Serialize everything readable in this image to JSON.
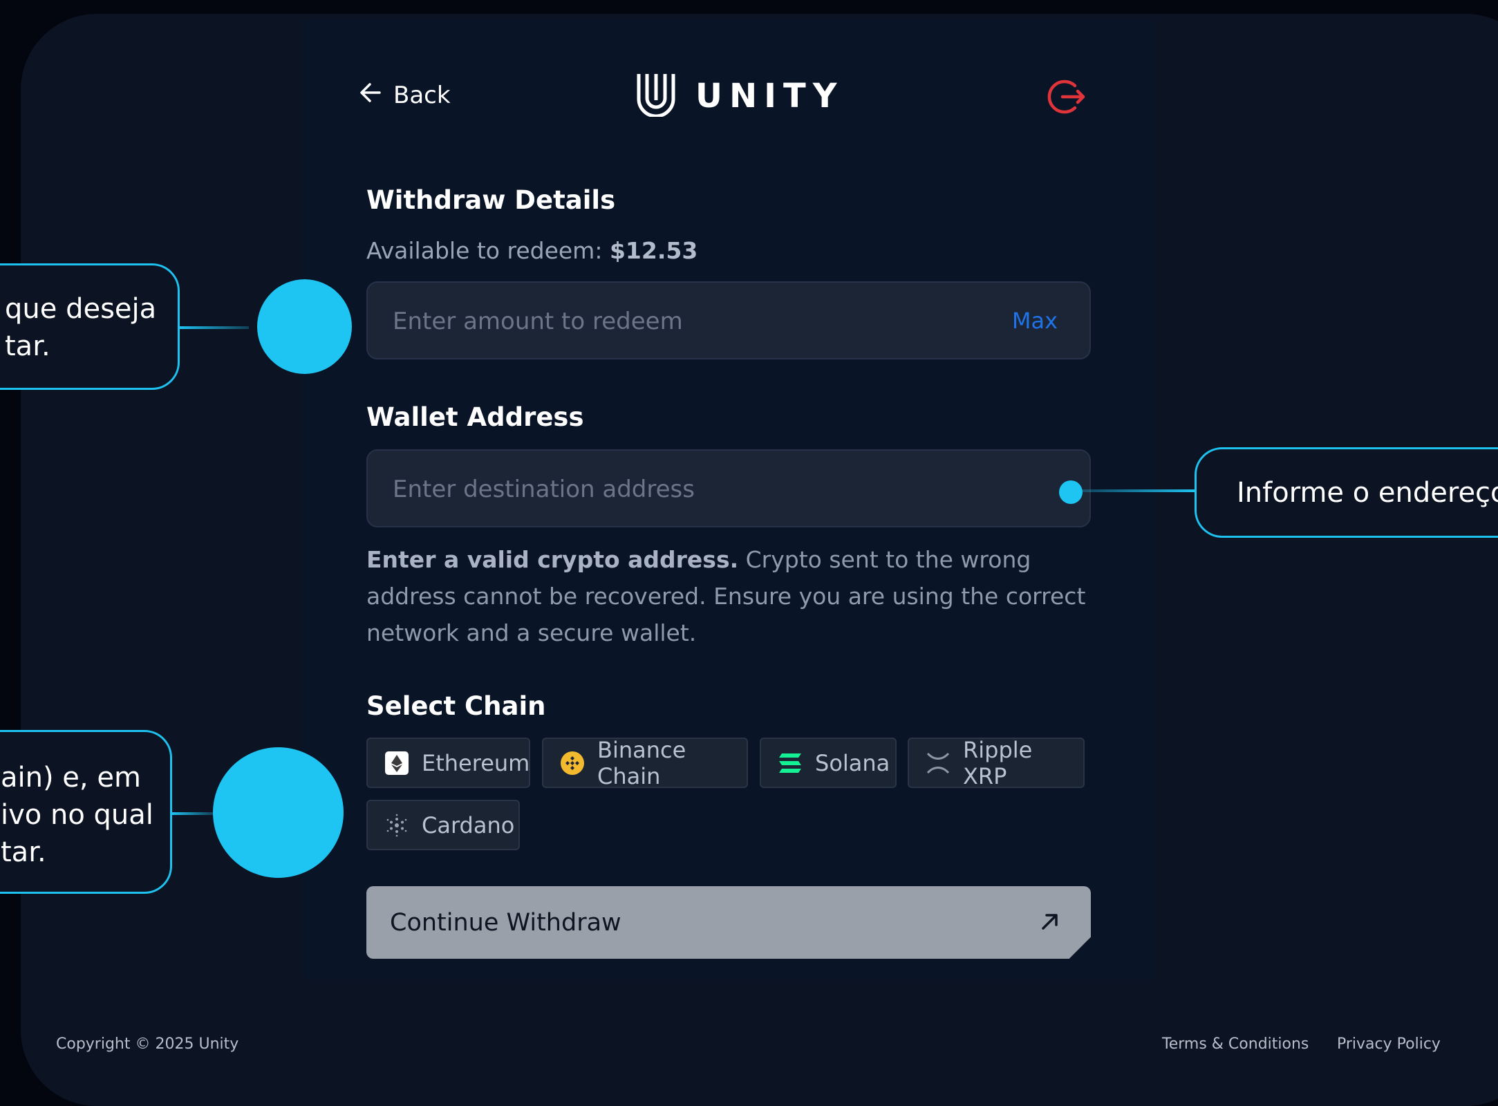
{
  "header": {
    "back_label": "Back",
    "brand_name": "UNITY"
  },
  "withdraw": {
    "title": "Withdraw Details",
    "available_label": "Available to redeem:",
    "available_amount": "$12.53",
    "amount_placeholder": "Enter amount to redeem",
    "max_label": "Max"
  },
  "wallet": {
    "title": "Wallet Address",
    "address_placeholder": "Enter destination address",
    "notice_bold": "Enter a valid crypto address.",
    "notice_text": "Crypto sent to the wrong address cannot be recovered. Ensure you are using the correct network and a secure wallet."
  },
  "chain": {
    "title": "Select Chain",
    "options": [
      {
        "label": "Ethereum",
        "icon": "ethereum-icon"
      },
      {
        "label": "Binance Chain",
        "icon": "binance-icon"
      },
      {
        "label": "Solana",
        "icon": "solana-icon"
      },
      {
        "label": "Ripple XRP",
        "icon": "ripple-icon"
      },
      {
        "label": "Cardano",
        "icon": "cardano-icon"
      }
    ]
  },
  "continue_label": "Continue Withdraw",
  "callouts": {
    "amount": "que deseja\ntar.",
    "address": "Informe o endereço d",
    "chain": "ain) e, em\nivo no qual\ntar."
  },
  "footer": {
    "copyright": "Copyright © 2025 Unity",
    "terms": "Terms & Conditions",
    "privacy": "Privacy Policy"
  },
  "colors": {
    "accent": "#1ec2f0",
    "logout": "#e0343b",
    "max_link": "#1f73e6",
    "button_bg": "#9aa0aa"
  }
}
